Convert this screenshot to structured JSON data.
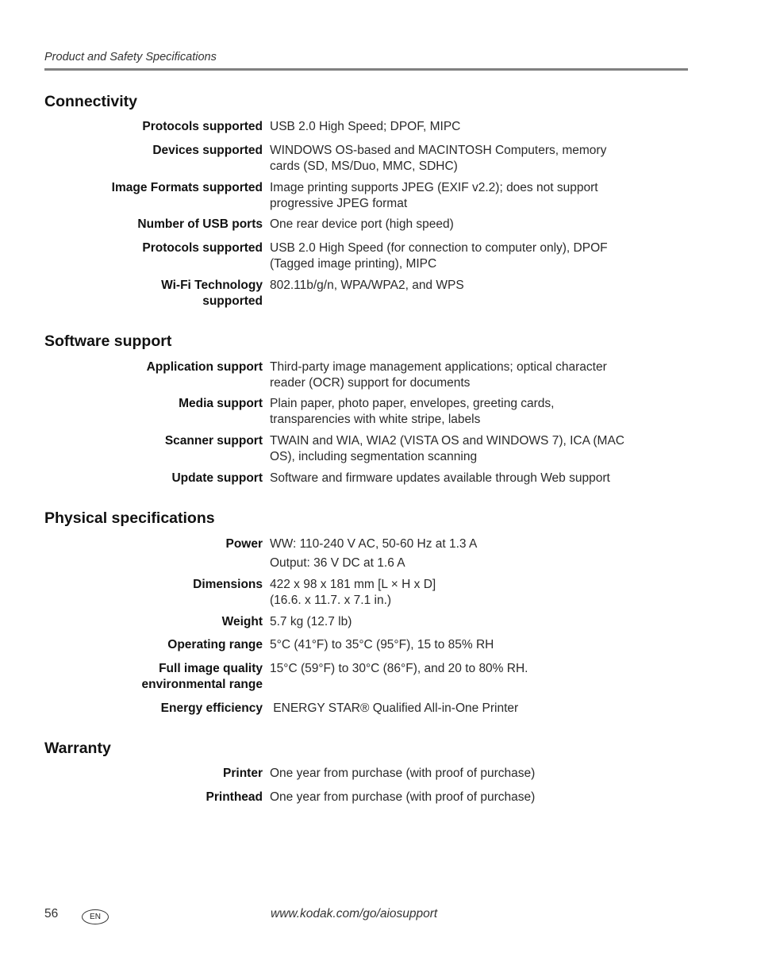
{
  "header": {
    "running_title": "Product and Safety Specifications"
  },
  "sections": [
    {
      "title": "Connectivity",
      "rows": [
        {
          "label": "Protocols supported",
          "lines": [
            "USB 2.0 High Speed; DPOF, MIPC"
          ]
        },
        {
          "label": "Devices supported",
          "lines": [
            "WINDOWS OS-based and MACINTOSH Computers, memory cards (SD, MS/Duo, MMC, SDHC)"
          ]
        },
        {
          "label": "Image Formats supported",
          "lines": [
            "Image printing supports JPEG (EXIF v2.2); does not support progressive JPEG format"
          ]
        },
        {
          "label": "Number of USB ports",
          "lines": [
            "One rear device port (high speed)"
          ]
        },
        {
          "label": "Protocols supported",
          "lines": [
            "USB 2.0 High Speed (for connection to computer only), DPOF (Tagged image printing), MIPC"
          ]
        },
        {
          "label": "Wi-Fi Technology supported",
          "lines": [
            "802.11b/g/n, WPA/WPA2, and WPS"
          ]
        }
      ]
    },
    {
      "title": "Software support",
      "rows": [
        {
          "label": "Application support",
          "lines": [
            "Third-party image management applications; optical character reader (OCR) support for documents"
          ]
        },
        {
          "label": "Media support",
          "lines": [
            "Plain paper, photo paper, envelopes, greeting cards, transparencies with white stripe, labels"
          ]
        },
        {
          "label": "Scanner support",
          "lines": [
            "TWAIN and WIA, WIA2 (VISTA OS and WINDOWS 7), ICA (MAC OS), including segmentation scanning"
          ]
        },
        {
          "label": "Update support",
          "lines": [
            "Software and firmware updates available through Web support"
          ]
        }
      ]
    },
    {
      "title": "Physical specifications",
      "rows": [
        {
          "label": "Power",
          "lines": [
            "WW: 110-240 V AC, 50-60 Hz at 1.3 A",
            "Output: 36 V DC at 1.6 A"
          ]
        },
        {
          "label": "Dimensions",
          "lines": [
            "422 x 98 x 181 mm [L × H x D]",
            "(16.6. x 11.7. x 7.1 in.)"
          ]
        },
        {
          "label": "Weight",
          "lines": [
            "5.7 kg (12.7 lb)"
          ]
        },
        {
          "label": "Operating range",
          "lines": [
            "5°C (41°F) to 35°C (95°F), 15 to 85% RH"
          ]
        },
        {
          "label": "Full image quality environmental range",
          "lines": [
            "15°C (59°F) to 30°C (86°F), and 20 to 80% RH."
          ]
        },
        {
          "label": "Energy efficiency",
          "lines": [
            " ENERGY STAR® Qualified All-in-One Printer"
          ]
        }
      ]
    },
    {
      "title": "Warranty",
      "rows": [
        {
          "label": "Printer",
          "lines": [
            "One year from purchase (with proof of purchase)"
          ]
        },
        {
          "label": "Printhead",
          "lines": [
            "One year from purchase (with proof of purchase)"
          ]
        }
      ]
    }
  ],
  "footer": {
    "page_number": "56",
    "language_badge": "EN",
    "url": "www.kodak.com/go/aiosupport"
  }
}
